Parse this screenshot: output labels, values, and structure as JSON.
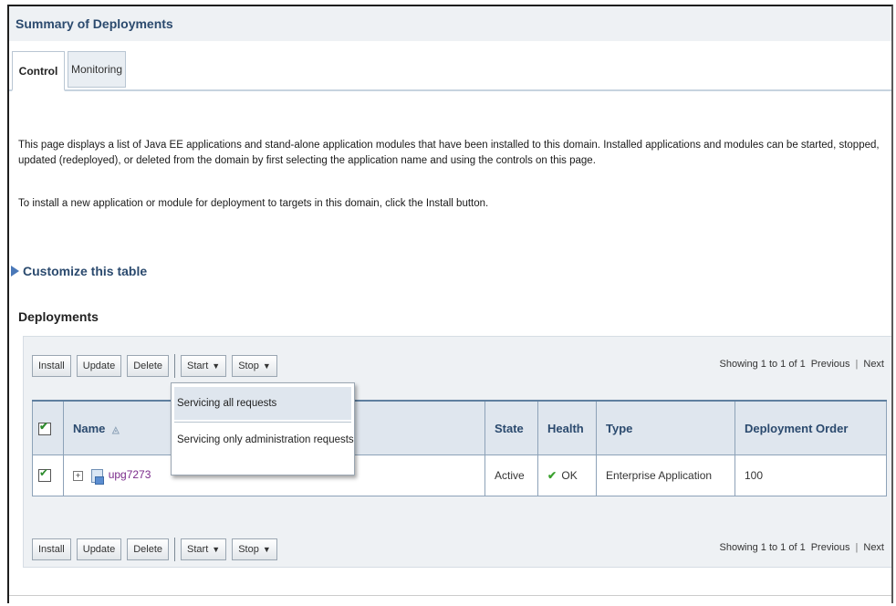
{
  "page": {
    "title": "Summary of Deployments",
    "tabs": [
      {
        "label": "Control",
        "active": true
      },
      {
        "label": "Monitoring",
        "active": false
      }
    ],
    "description_1": "This page displays a list of Java EE applications and stand-alone application modules that have been installed to this domain. Installed applications and modules can be started, stopped, updated (redeployed), or deleted from the domain by first selecting the application name and using the controls on this page.",
    "description_2": "To install a new application or module for deployment to targets in this domain, click the Install button.",
    "customize_link": "Customize this table",
    "section_title": "Deployments"
  },
  "toolbar": {
    "install": "Install",
    "update": "Update",
    "delete": "Delete",
    "start": "Start",
    "stop": "Stop",
    "paging_text": "Showing 1 to 1 of 1",
    "previous": "Previous",
    "next": "Next"
  },
  "start_menu": {
    "items": [
      "Servicing all requests",
      "Servicing only administration requests"
    ]
  },
  "table": {
    "columns": {
      "name": "Name",
      "state": "State",
      "health": "Health",
      "type": "Type",
      "order": "Deployment Order"
    },
    "rows": [
      {
        "name": "upg7273",
        "state": "Active",
        "health": "OK",
        "type": "Enterprise Application",
        "order": "100",
        "selected": true
      }
    ]
  },
  "colors": {
    "accent": "#2b4a6e",
    "header_bg": "#dfe6ee",
    "panel_bg": "#eef1f4",
    "link_visited": "#7a2a8a",
    "ok_green": "#3aa12e"
  }
}
